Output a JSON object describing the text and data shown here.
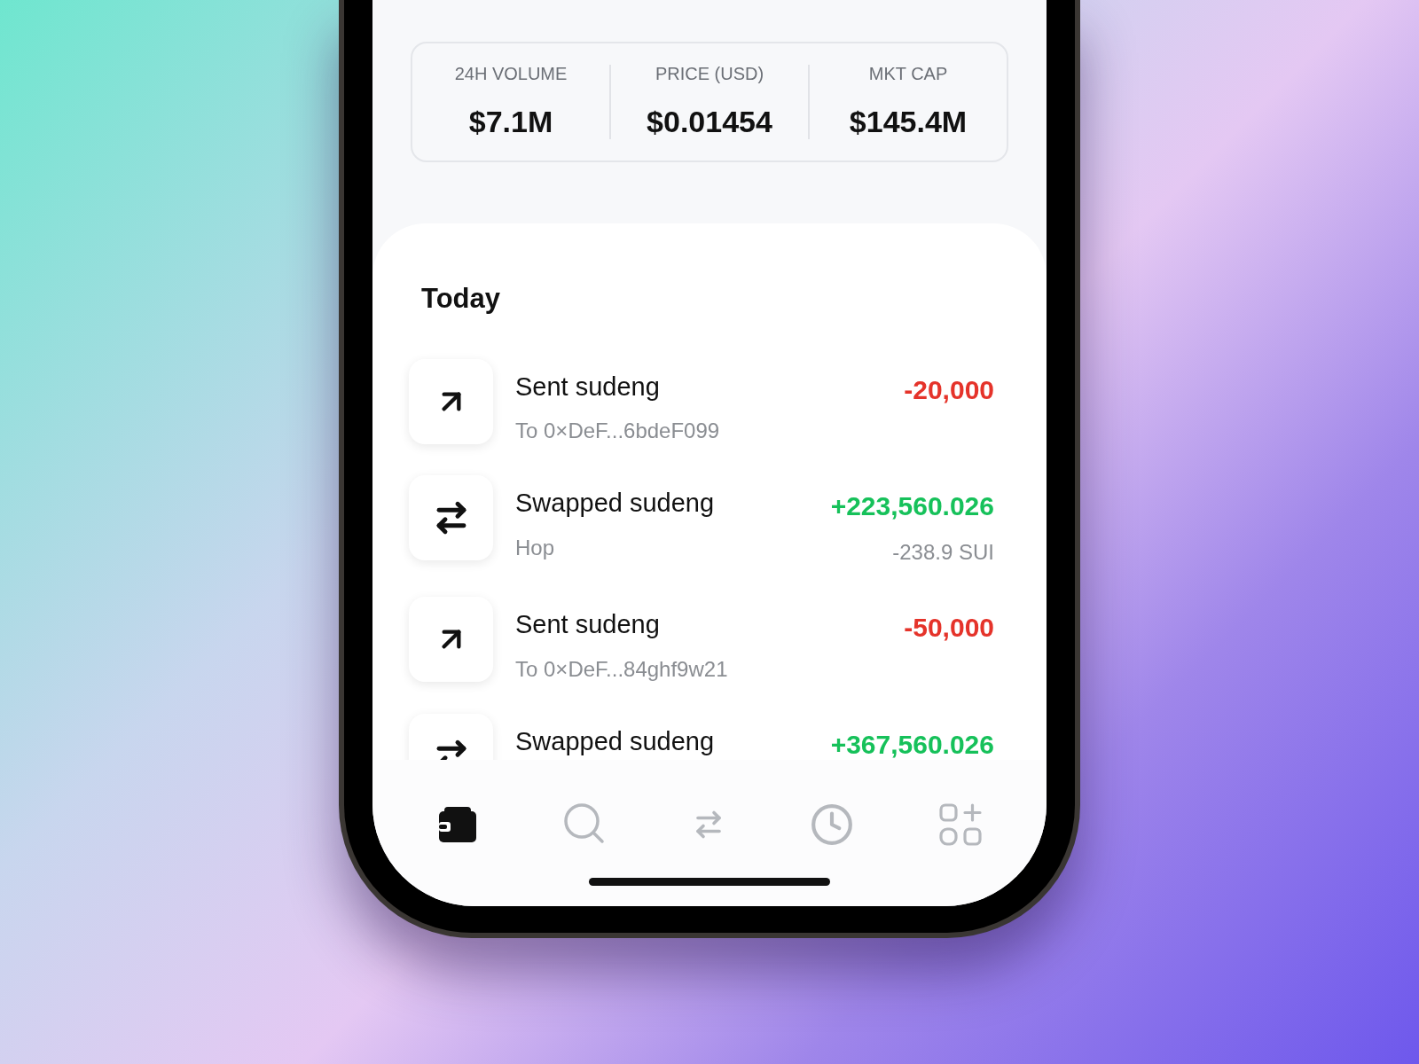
{
  "stats": [
    {
      "label": "24H VOLUME",
      "value": "$7.1M"
    },
    {
      "label": "PRICE (USD)",
      "value": "$0.01454"
    },
    {
      "label": "MKT CAP",
      "value": "$145.4M"
    }
  ],
  "section_title": "Today",
  "transactions": [
    {
      "kind": "sent",
      "title": "Sent sudeng",
      "subtitle": "To 0×DeF...6bdeF099",
      "amount": "-20,000"
    },
    {
      "kind": "swap",
      "title": "Swapped sudeng",
      "subtitle": "Hop",
      "amount": "+223,560.026",
      "secondary": "-238.9 SUI"
    },
    {
      "kind": "sent",
      "title": "Sent sudeng",
      "subtitle": "To 0×DeF...84ghf9w21",
      "amount": "-50,000"
    },
    {
      "kind": "swap",
      "title": "Swapped sudeng",
      "amount": "+367,560.026"
    }
  ],
  "nav": [
    {
      "kind": "wallet",
      "selected": true
    },
    {
      "kind": "search",
      "selected": false
    },
    {
      "kind": "swap",
      "selected": false
    },
    {
      "kind": "history",
      "selected": false
    },
    {
      "kind": "apps",
      "selected": false
    }
  ]
}
